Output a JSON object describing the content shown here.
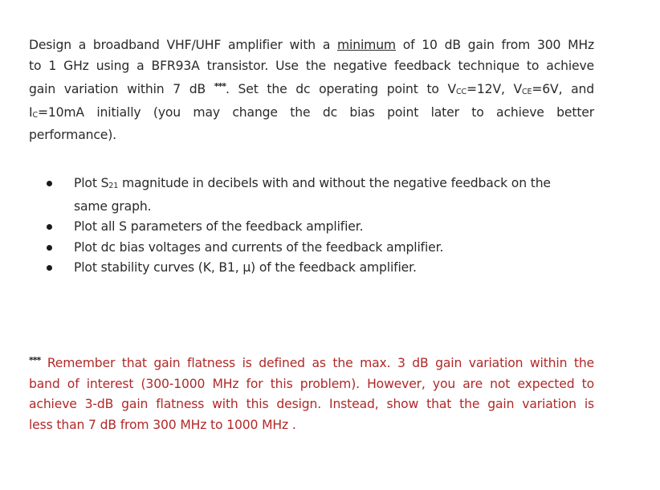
{
  "intro": {
    "lines": [
      {
        "before": "Design a broadband VHF/UHF amplifier with a ",
        "underlined": "minimum",
        "after": " of 10 dB gain from 300 MHz"
      },
      {
        "text": "to 1 GHz using a BFR93A transistor. Use the negative feedback technique to achieve"
      },
      {
        "before": "gain variation within 7 dB ",
        "stars": "***",
        "after_stars": ". Set the dc operating point to V",
        "vcc_sub": "CC",
        "vcc_val": "=12V, V",
        "vce_sub": "CE",
        "vce_val": "=6V, and"
      },
      {
        "ic_base": "I",
        "ic_sub": "C",
        "rest": "=10mA initially (you may change the dc bias point later to achieve better"
      },
      {
        "text": "performance)."
      }
    ]
  },
  "tasks": [
    {
      "prefix": "Plot S",
      "sub": "21",
      "line1_rest": " magnitude in decibels with and without the negative feedback on the",
      "line2": "same graph."
    },
    {
      "text": "Plot all S parameters of the feedback amplifier."
    },
    {
      "text": "Plot dc bias voltages and currents of the feedback amplifier."
    },
    {
      "text": "Plot stability curves (K, B1, μ) of the feedback amplifier."
    }
  ],
  "note": {
    "stars": "***",
    "lines": [
      " Remember that gain flatness is defined as the max. 3 dB gain variation within the",
      "band of interest (300-1000 MHz for this problem). However, you are not expected to",
      "achieve 3-dB gain flatness with this design. Instead, show that the gain variation is",
      "less than 7 dB from 300 MHz to 1000 MHz ."
    ],
    "color": "#b22828"
  }
}
